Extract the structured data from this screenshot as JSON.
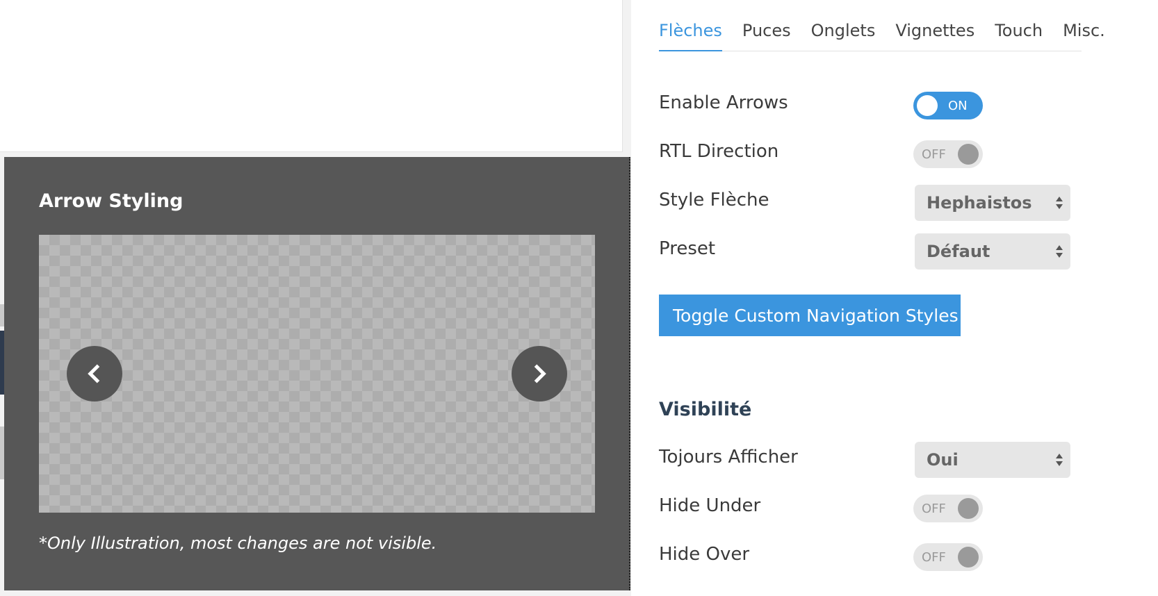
{
  "tabs": [
    {
      "label": "Flèches",
      "active": true
    },
    {
      "label": "Puces"
    },
    {
      "label": "Onglets"
    },
    {
      "label": "Vignettes"
    },
    {
      "label": "Touch"
    },
    {
      "label": "Misc."
    }
  ],
  "settings": {
    "enable_arrows": {
      "label": "Enable Arrows",
      "state": "ON"
    },
    "rtl_direction": {
      "label": "RTL Direction",
      "state": "OFF"
    },
    "arrow_style": {
      "label": "Style Flèche",
      "value": "Hephaistos"
    },
    "preset": {
      "label": "Preset",
      "value": "Défaut"
    },
    "toggle_button_label": "Toggle Custom Navigation Styles"
  },
  "visibility": {
    "heading": "Visibilité",
    "always_show": {
      "label": "Tojours Afficher",
      "value": "Oui"
    },
    "hide_under": {
      "label": "Hide Under",
      "state": "OFF"
    },
    "hide_over": {
      "label": "Hide Over",
      "state": "OFF"
    }
  },
  "preview": {
    "title": "Arrow Styling",
    "note": "*Only Illustration, most changes are not visible."
  },
  "colors": {
    "accent": "#3b95de",
    "panel_dark": "#575757",
    "heading": "#2f4256"
  }
}
